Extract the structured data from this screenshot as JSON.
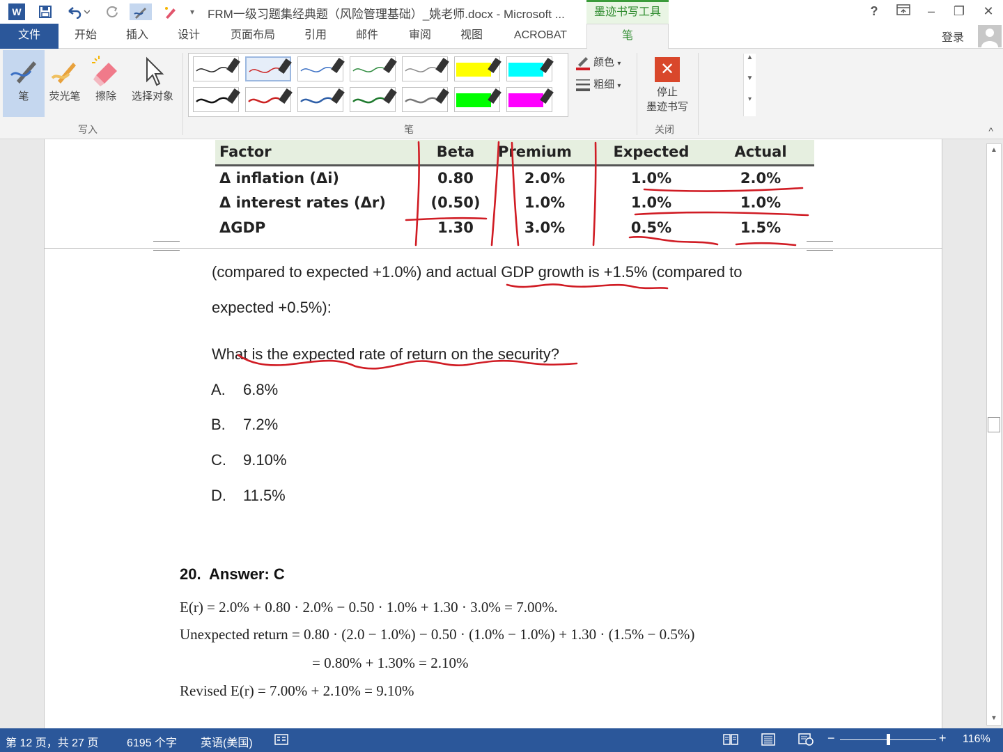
{
  "window": {
    "title": "FRM一级习题集经典题（风险管理基础）_姚老师.docx - Microsoft ...",
    "context_tab": "墨迹书写工具",
    "help": "?",
    "min": "‒",
    "restore": "❐",
    "close": "✕"
  },
  "tabs": {
    "file": "文件",
    "home": "开始",
    "insert": "插入",
    "design": "设计",
    "layout": "页面布局",
    "references": "引用",
    "mailings": "邮件",
    "review": "审阅",
    "view": "视图",
    "acrobat": "ACROBAT",
    "pen": "笔",
    "login": "登录"
  },
  "ribbon": {
    "pen": "笔",
    "highlighter": "荧光笔",
    "eraser": "擦除",
    "select": "选择对象",
    "group_write": "写入",
    "group_pens": "笔",
    "color": "颜色",
    "thickness": "粗细",
    "stop_line1": "停止",
    "stop_line2": "墨迹书写",
    "group_close": "关闭",
    "swatches": [
      {
        "kind": "line",
        "color": "#222222"
      },
      {
        "kind": "line",
        "color": "#cc2222"
      },
      {
        "kind": "line",
        "color": "#3a6fc4"
      },
      {
        "kind": "line",
        "color": "#2e8b3e"
      },
      {
        "kind": "line",
        "color": "#888888"
      },
      {
        "kind": "fill",
        "color": "#ffff00"
      },
      {
        "kind": "fill",
        "color": "#00ffff"
      },
      {
        "kind": "line",
        "color": "#111111"
      },
      {
        "kind": "line",
        "color": "#cc2222"
      },
      {
        "kind": "line",
        "color": "#2e5fa8"
      },
      {
        "kind": "line",
        "color": "#1f7a2e"
      },
      {
        "kind": "line",
        "color": "#777777"
      },
      {
        "kind": "fill",
        "color": "#00ff00"
      },
      {
        "kind": "fill",
        "color": "#ff00ff"
      }
    ]
  },
  "table": {
    "headers": [
      "Factor",
      "Beta",
      "Premium",
      "Expected",
      "Actual"
    ],
    "rows": [
      [
        "Δ inflation (Δi)",
        "0.80",
        "2.0%",
        "1.0%",
        "2.0%"
      ],
      [
        "Δ interest rates (Δr)",
        "(0.50)",
        "1.0%",
        "1.0%",
        "1.0%"
      ],
      [
        "ΔGDP",
        "1.30",
        "3.0%",
        "0.5%",
        "1.5%"
      ]
    ]
  },
  "doc": {
    "line1": "(compared  to  expected  +1.0%)  and  actual  GDP  growth  is  +1.5%  (compared  to",
    "line2": "expected +0.5%):",
    "question": "What is the expected rate of return on the security?",
    "options": [
      {
        "letter": "A.",
        "text": "6.8%"
      },
      {
        "letter": "B.",
        "text": "7.2%"
      },
      {
        "letter": "C.",
        "text": "9.10%"
      },
      {
        "letter": "D.",
        "text": "11.5%"
      }
    ],
    "answer_num": "20.",
    "answer_text": "Answer: C",
    "formula1": "E(r) = 2.0% + 0.80 · 2.0% − 0.50 · 1.0% + 1.30 · 3.0% = 7.00%.",
    "formula2": "Unexpected return = 0.80 · (2.0 − 1.0%) − 0.50 · (1.0% − 1.0%) + 1.30 · (1.5% − 0.5%)",
    "formula3": "= 0.80% + 1.30% = 2.10%",
    "formula4": "Revised E(r) = 7.00% + 2.10% = 9.10%"
  },
  "status": {
    "page": "第 12 页，共 27 页",
    "words": "6195 个字",
    "lang": "英语(美国)",
    "zoom": "116%",
    "zoom_minus": "−",
    "zoom_plus": "+"
  },
  "colors": {
    "accent": "#2b579a",
    "ink": "#d01c24",
    "context_green": "#2f8c2f"
  }
}
